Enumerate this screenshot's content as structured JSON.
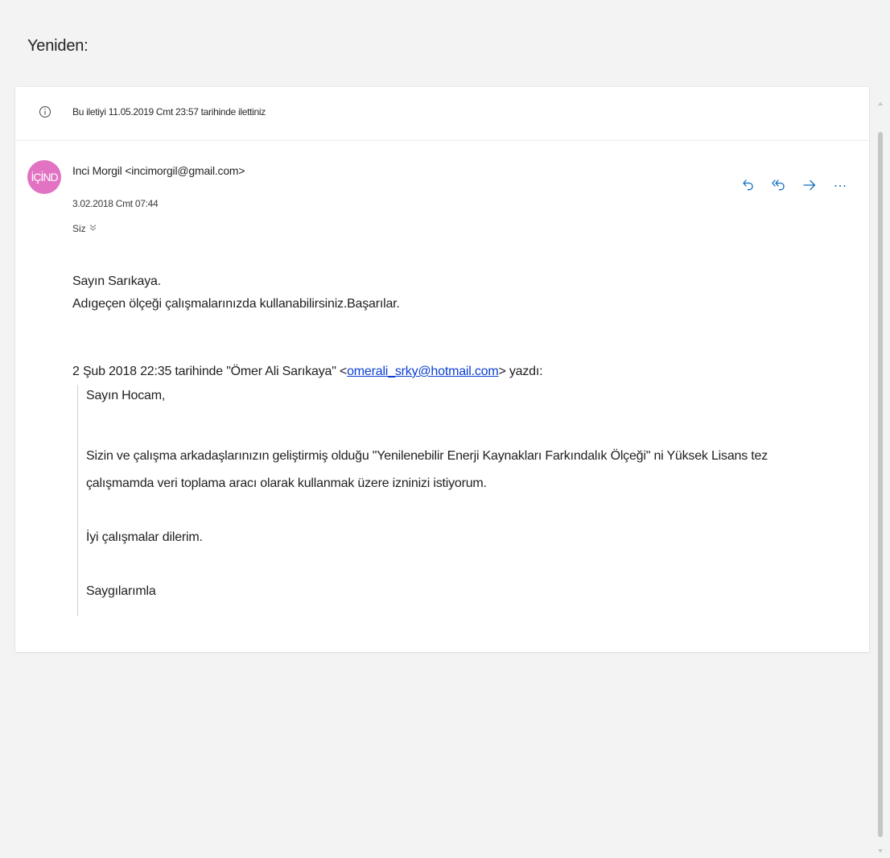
{
  "subject": "Yeniden:",
  "info": {
    "icon": "info-icon",
    "text": "Bu iletiyi 11.05.2019 Cmt 23:57 tarihinde ilettiniz"
  },
  "message": {
    "avatar_initials": "İÇİND",
    "avatar_color": "#e173c2",
    "sender": "Inci Morgil <incimorgil@gmail.com>",
    "date": "3.02.2018 Cmt 07:44",
    "recipients": "Siz",
    "actions": {
      "reply_icon": "reply-icon",
      "reply_all_icon": "reply-all-icon",
      "forward_icon": "forward-icon",
      "more_icon": "more-icon"
    },
    "body": {
      "line1": "Sayın Sarıkaya.",
      "line2": "Adıgeçen ölçeği çalışmalarınızda kullanabilirsiniz.Başarılar."
    },
    "attribution": {
      "prefix": "2 Şub 2018 22:35 tarihinde \"Ömer Ali Sarıkaya\" <",
      "email": "omerali_srky@hotmail.com",
      "suffix": "> yazdı:"
    },
    "quote": {
      "greeting": "Sayın Hocam,",
      "para1_line1": "Sizin ve çalışma arkadaşlarınızın geliştirmiş olduğu \"Yenilenebilir Enerji Kaynakları Farkındalık Ölçeği\" ni Yüksek Lisans tez",
      "para1_line2": "çalışmamda veri toplama aracı olarak kullanmak üzere izninizi istiyorum.",
      "closing": "İyi çalışmalar dilerim.",
      "signoff": "Saygılarımla"
    }
  },
  "colors": {
    "accent": "#0f6cbd",
    "link": "#0b3fd1",
    "background": "#f3f3f3"
  }
}
